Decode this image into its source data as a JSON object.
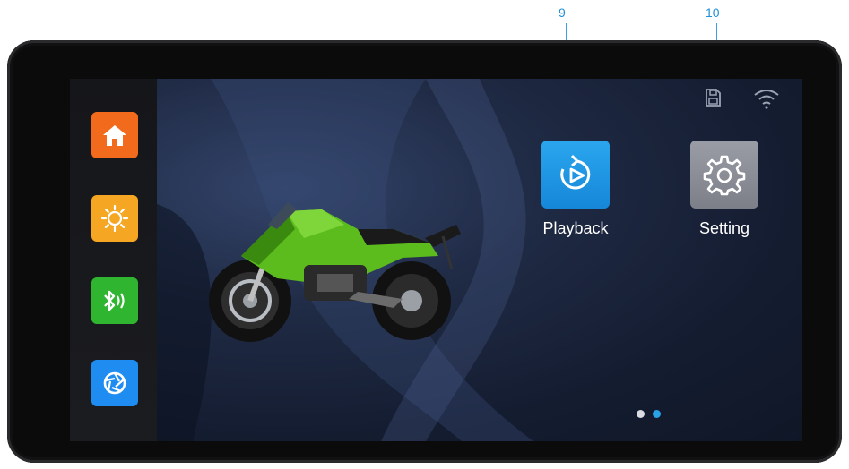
{
  "callouts": [
    {
      "number": "9"
    },
    {
      "number": "10"
    }
  ],
  "status_bar": {
    "icons": [
      "sd-card-icon",
      "wifi-icon",
      "bluetooth-icon"
    ]
  },
  "dock": {
    "items": [
      {
        "icon": "home-icon",
        "color": "#f26b1d"
      },
      {
        "icon": "brightness-icon",
        "color": "#f5a623"
      },
      {
        "icon": "bluetooth-audio-icon",
        "color": "#2fb52f"
      },
      {
        "icon": "camera-aperture-icon",
        "color": "#1e8cf0"
      }
    ]
  },
  "apps": [
    {
      "label": "Playback",
      "icon": "playback-icon",
      "color": "#1f9be8"
    },
    {
      "label": "Setting",
      "icon": "gear-icon",
      "color": "#8c8f99"
    }
  ],
  "pagination": {
    "pages": 2,
    "active": 2
  },
  "colors": {
    "accent": "#2aa3e6"
  }
}
